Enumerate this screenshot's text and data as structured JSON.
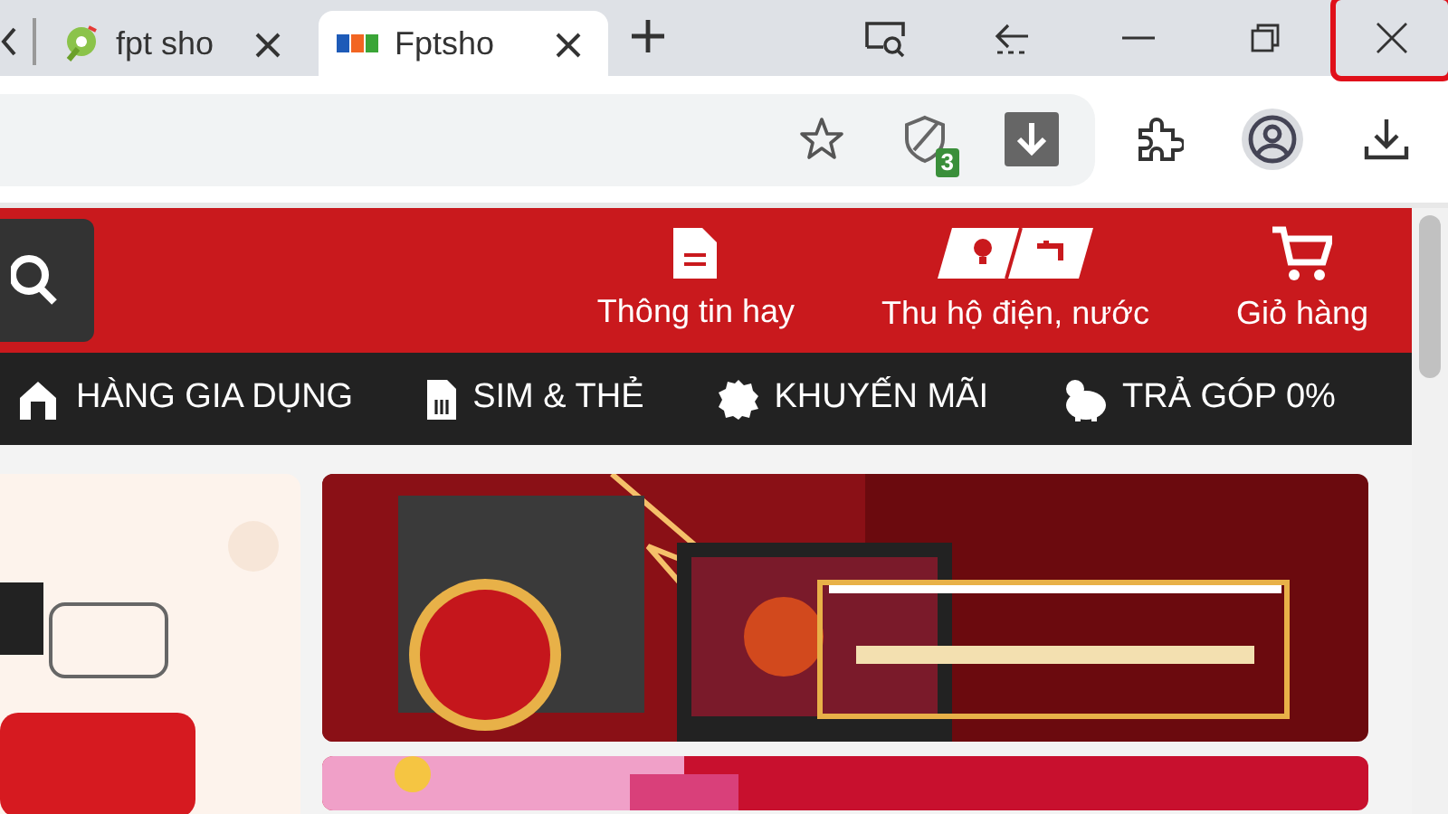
{
  "tabs": [
    {
      "title": "fpt sho",
      "selected": false
    },
    {
      "title": "Fptsho",
      "selected": true
    }
  ],
  "toolbar": {
    "shield_badge": "3"
  },
  "header": {
    "links": [
      {
        "label": "Thông tin hay"
      },
      {
        "label": "Thu hộ điện, nước"
      },
      {
        "label": "Giỏ hàng"
      }
    ]
  },
  "nav": [
    {
      "label": "HÀNG GIA DỤNG"
    },
    {
      "label": "SIM & THẺ"
    },
    {
      "label": "KHUYẾN MÃI"
    },
    {
      "label": "TRẢ GÓP 0%"
    }
  ]
}
